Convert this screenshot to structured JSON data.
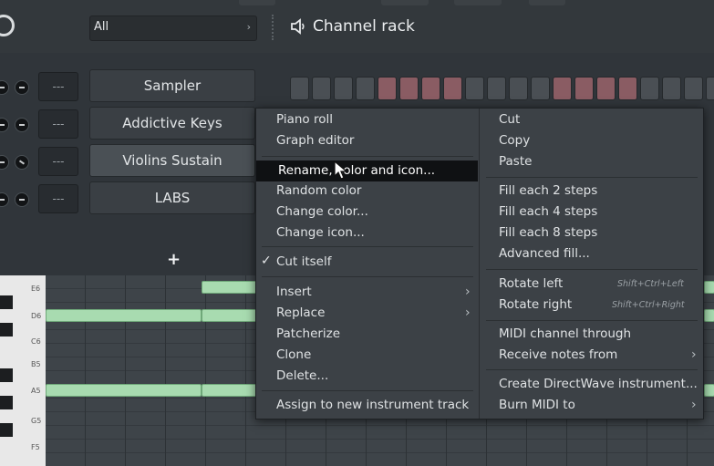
{
  "toolbar": {
    "filter_value": "All",
    "filter_arrow": "›",
    "rack_title": "Channel rack",
    "rack_icon": "speaker-icon"
  },
  "channels": [
    {
      "name": "Sampler",
      "mixer": "---"
    },
    {
      "name": "Addictive Keys",
      "mixer": "---"
    },
    {
      "name": "Violins Sustain",
      "mixer": "---"
    },
    {
      "name": "LABS",
      "mixer": "---"
    }
  ],
  "add_channel": "+",
  "piano_keys": [
    "E6",
    "D6",
    "C6",
    "B5",
    "A5",
    "G5",
    "F5"
  ],
  "context_menu": {
    "left": {
      "piano_roll": "Piano roll",
      "graph_editor": "Graph editor",
      "rename": "Rename, color and icon...",
      "random_color": "Random color",
      "change_color": "Change color...",
      "change_icon": "Change icon...",
      "cut_itself": "Cut itself",
      "insert": "Insert",
      "replace": "Replace",
      "patcherize": "Patcherize",
      "clone": "Clone",
      "delete": "Delete...",
      "assign": "Assign to new instrument track"
    },
    "right": {
      "cut": "Cut",
      "copy": "Copy",
      "paste": "Paste",
      "fill2": "Fill each 2 steps",
      "fill4": "Fill each 4 steps",
      "fill8": "Fill each 8 steps",
      "advanced_fill": "Advanced fill...",
      "rotate_left": "Rotate left",
      "rotate_left_sc": "Shift+Ctrl+Left",
      "rotate_right": "Rotate right",
      "rotate_right_sc": "Shift+Ctrl+Right",
      "midi_through": "MIDI channel through",
      "receive_notes": "Receive notes from",
      "create_directwave": "Create DirectWave instrument...",
      "burn_midi": "Burn MIDI to"
    },
    "check_mark": "✓",
    "submenu_arrow": "›"
  },
  "colors": {
    "menu_bg": "#3c4146",
    "highlight_bg": "#0f1113",
    "step_red": "#8a5c63",
    "note_green": "#a8dbb0"
  }
}
